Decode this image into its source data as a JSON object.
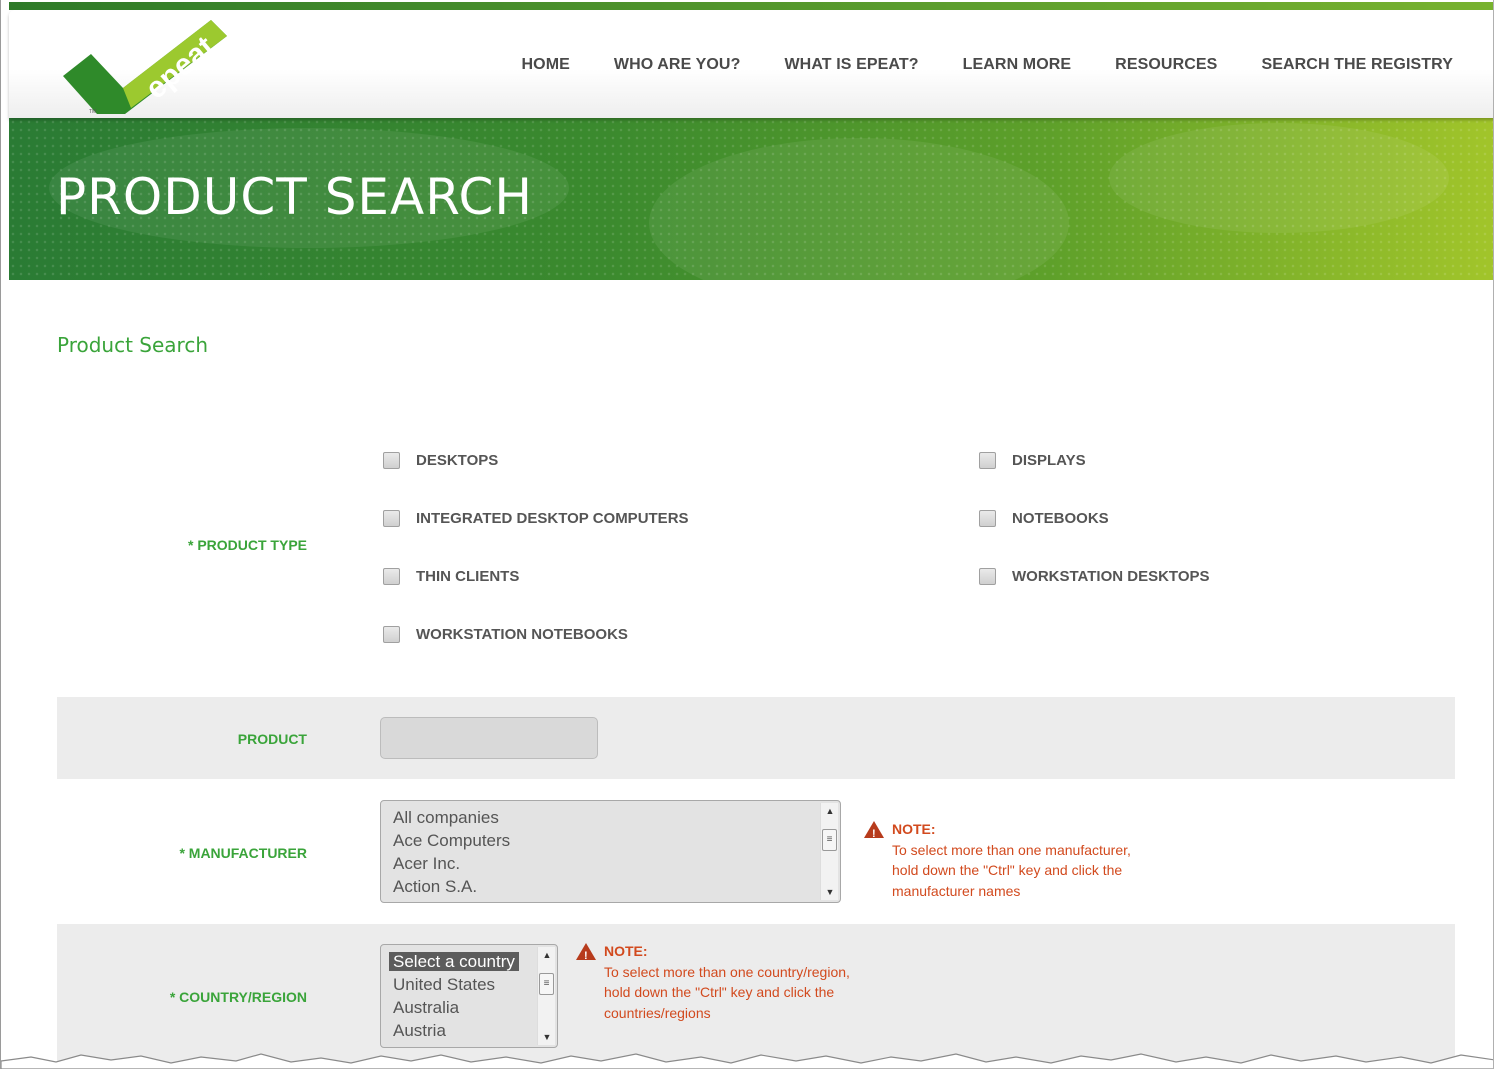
{
  "header": {
    "logo_text": "epeat",
    "nav": [
      {
        "label": "HOME"
      },
      {
        "label": "WHO ARE YOU?"
      },
      {
        "label": "WHAT IS EPEAT?"
      },
      {
        "label": "LEARN MORE"
      },
      {
        "label": "RESOURCES"
      },
      {
        "label": "SEARCH THE REGISTRY"
      }
    ]
  },
  "banner": {
    "title": "PRODUCT SEARCH"
  },
  "page": {
    "section_title": "Product Search"
  },
  "form": {
    "product_type": {
      "label": "* PRODUCT TYPE",
      "options": [
        {
          "label": "DESKTOPS",
          "checked": false
        },
        {
          "label": "DISPLAYS",
          "checked": false
        },
        {
          "label": "INTEGRATED DESKTOP COMPUTERS",
          "checked": false
        },
        {
          "label": "NOTEBOOKS",
          "checked": false
        },
        {
          "label": "THIN CLIENTS",
          "checked": false
        },
        {
          "label": "WORKSTATION DESKTOPS",
          "checked": false
        },
        {
          "label": "WORKSTATION NOTEBOOKS",
          "checked": false
        }
      ]
    },
    "product": {
      "label": "PRODUCT",
      "value": ""
    },
    "manufacturer": {
      "label": "* MANUFACTURER",
      "options": [
        "All companies",
        "Ace Computers",
        "Acer Inc.",
        "Action S.A."
      ],
      "note_head": "NOTE:",
      "note_lines": [
        "To select more than one manufacturer,",
        "hold down the \"Ctrl\" key and click the",
        "manufacturer names"
      ]
    },
    "country": {
      "label": "* COUNTRY/REGION",
      "options": [
        "Select a country",
        "United States",
        "Australia",
        "Austria"
      ],
      "selected": "Select a country",
      "note_head": "NOTE:",
      "note_lines": [
        "To select more than one country/region,",
        "hold down the \"Ctrl\" key and click the",
        "countries/regions"
      ]
    }
  },
  "colors": {
    "brand_green": "#3aa43a",
    "note_red": "#d24a1e",
    "banner_dark": "#2a7b34",
    "banner_light": "#a2c52a"
  }
}
